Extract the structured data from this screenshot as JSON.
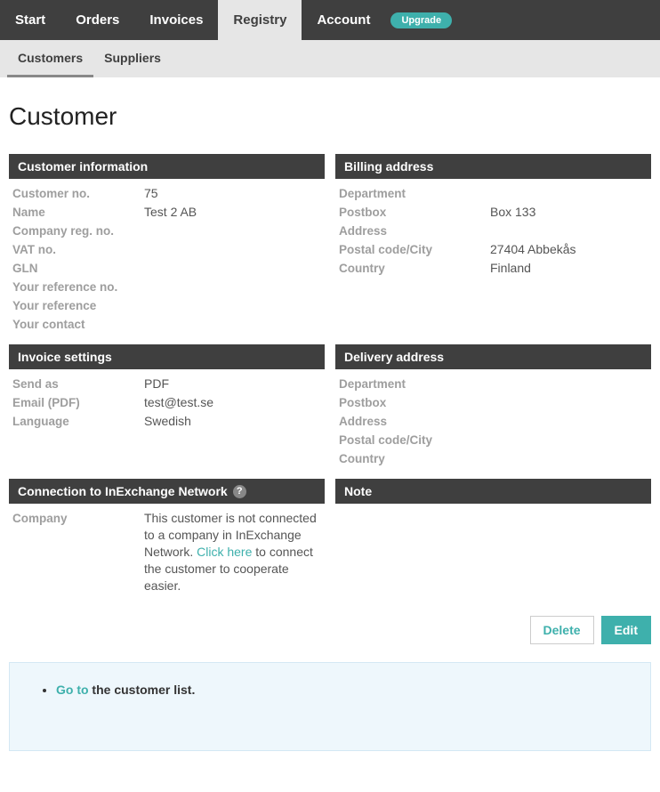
{
  "topnav": {
    "start": "Start",
    "orders": "Orders",
    "invoices": "Invoices",
    "registry": "Registry",
    "account": "Account",
    "upgrade": "Upgrade"
  },
  "subnav": {
    "customers": "Customers",
    "suppliers": "Suppliers"
  },
  "page_title": "Customer",
  "customer_info": {
    "header": "Customer information",
    "labels": {
      "customer_no": "Customer no.",
      "name": "Name",
      "company_reg_no": "Company reg. no.",
      "vat_no": "VAT no.",
      "gln": "GLN",
      "your_ref_no": "Your reference no.",
      "your_reference": "Your reference",
      "your_contact": "Your contact"
    },
    "values": {
      "customer_no": "75",
      "name": "Test 2 AB",
      "company_reg_no": "",
      "vat_no": "",
      "gln": "",
      "your_ref_no": "",
      "your_reference": "",
      "your_contact": ""
    }
  },
  "billing": {
    "header": "Billing address",
    "labels": {
      "department": "Department",
      "postbox": "Postbox",
      "address": "Address",
      "postal_city": "Postal code/City",
      "country": "Country"
    },
    "values": {
      "department": "",
      "postbox": "Box 133",
      "address": "",
      "postal_city": "27404  Abbekås",
      "country": "Finland"
    }
  },
  "invoice_settings": {
    "header": "Invoice settings",
    "labels": {
      "send_as": "Send as",
      "email_pdf": "Email (PDF)",
      "language": "Language"
    },
    "values": {
      "send_as": "PDF",
      "email_pdf": "test@test.se",
      "language": "Swedish"
    }
  },
  "delivery": {
    "header": "Delivery address",
    "labels": {
      "department": "Department",
      "postbox": "Postbox",
      "address": "Address",
      "postal_city": "Postal code/City",
      "country": "Country"
    },
    "values": {
      "department": "",
      "postbox": "",
      "address": "",
      "postal_city": "",
      "country": ""
    }
  },
  "connection": {
    "header": "Connection to InExchange Network",
    "labels": {
      "company": "Company"
    },
    "text_before": "This customer is not connected to a company in InExchange Network. ",
    "link_text": "Click here",
    "text_after": " to connect the customer to cooperate easier."
  },
  "note": {
    "header": "Note"
  },
  "actions": {
    "delete": "Delete",
    "edit": "Edit"
  },
  "notice": {
    "goto": "Go to",
    "rest": " the customer list."
  }
}
